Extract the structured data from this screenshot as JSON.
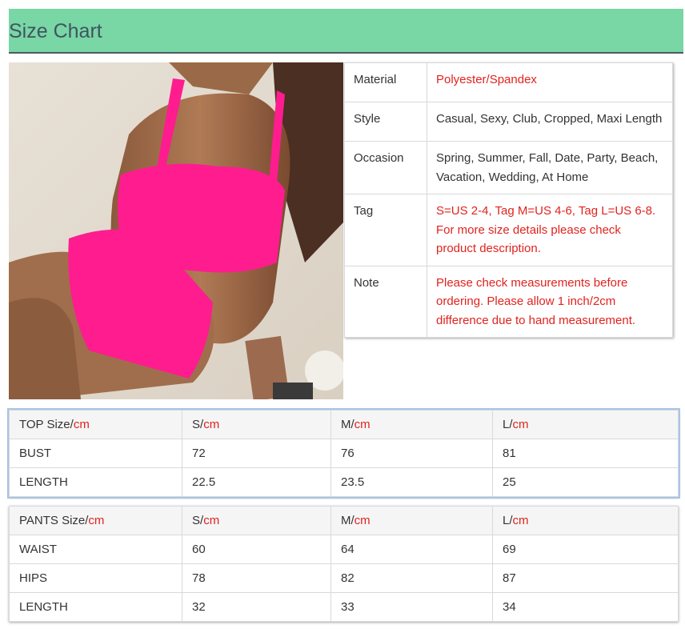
{
  "header": {
    "title": "Size Chart"
  },
  "photo": {
    "icon": "product-photo-pink-bikini"
  },
  "colors": {
    "header_bg": "#79d6a5",
    "accent_red": "#e0231f",
    "product_pink": "#ff1493"
  },
  "info": {
    "rows": [
      {
        "label": "Material",
        "value": "Polyester/Spandex"
      },
      {
        "label": "Style",
        "value": "Casual, Sexy, Club, Cropped, Maxi Length"
      },
      {
        "label": "Occasion",
        "value": "Spring, Summer, Fall, Date, Party, Beach, Vacation, Wedding, At Home"
      },
      {
        "label": "Tag",
        "value": "S=US 2-4, Tag M=US 4-6, Tag L=US 6-8. For more size details please check product description."
      },
      {
        "label": "Note",
        "value": "Please check measurements before ordering. Please allow 1 inch/2cm difference due to hand measurement."
      }
    ]
  },
  "top_table": {
    "unit": "cm",
    "header": [
      "TOP Size/",
      "S/",
      "M/",
      "L/"
    ],
    "rows": [
      [
        "BUST",
        "72",
        "76",
        "81"
      ],
      [
        "LENGTH",
        "22.5",
        "23.5",
        "25"
      ]
    ]
  },
  "pants_table": {
    "unit": "cm",
    "header": [
      "PANTS Size/",
      "S/",
      "M/",
      "L/"
    ],
    "rows": [
      [
        "WAIST",
        "60",
        "64",
        "69"
      ],
      [
        "HIPS",
        "78",
        "82",
        "87"
      ],
      [
        "LENGTH",
        "32",
        "33",
        "34"
      ]
    ]
  }
}
